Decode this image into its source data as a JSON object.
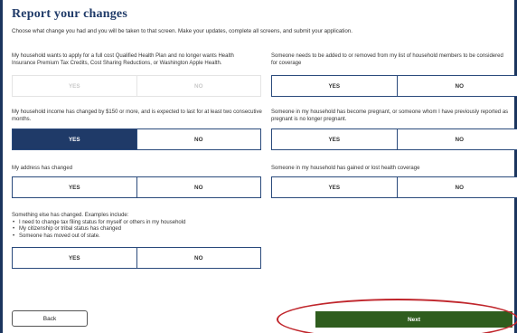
{
  "page": {
    "title": "Report your changes",
    "intro": "Choose what change you had and you will be taken to that screen. Make your updates, complete all screens, and submit your application."
  },
  "questions": [
    {
      "text": "My household wants to apply for a full cost Qualified Health Plan and no longer wants Health Insurance Premium Tax Credits, Cost Sharing Reductions, or Washington Apple Health.",
      "yes": "YES",
      "no": "NO",
      "state": "disabled"
    },
    {
      "text": "Someone needs to be added to or removed from my list of household members to be considered for coverage",
      "yes": "YES",
      "no": "NO",
      "state": "none"
    },
    {
      "text": "My household income has changed by $150 or more, and is expected to last for at least two consecutive months.",
      "yes": "YES",
      "no": "NO",
      "state": "yes"
    },
    {
      "text": "Someone in my household has become pregnant, or someone whom I have previously reported as pregnant is no longer pregnant.",
      "yes": "YES",
      "no": "NO",
      "state": "none"
    },
    {
      "text": "My address has changed",
      "yes": "YES",
      "no": "NO",
      "state": "none"
    },
    {
      "text": "Someone in my household has gained or lost health coverage",
      "yes": "YES",
      "no": "NO",
      "state": "none"
    },
    {
      "text": "Something else has changed. Examples include:",
      "bullets": [
        "I need to change tax filing status for myself or others in my household",
        "My citizenship or tribal status has changed",
        "Someone has moved out of state."
      ],
      "yes": "YES",
      "no": "NO",
      "state": "none"
    }
  ],
  "footer": {
    "back_label": "Back",
    "next_label": "Next"
  },
  "colors": {
    "navy": "#1f3a68",
    "next_green": "#2f5d1e",
    "annotation_red": "#c0262c"
  }
}
